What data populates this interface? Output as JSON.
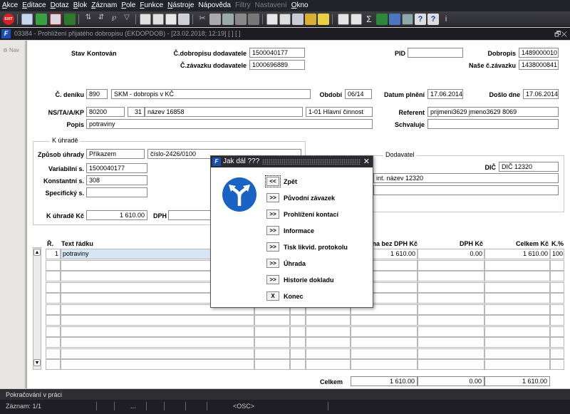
{
  "menu": [
    {
      "label": "Akce",
      "key": "A",
      "rest": "kce",
      "enabled": true
    },
    {
      "label": "Editace",
      "key": "E",
      "rest": "ditace",
      "enabled": true
    },
    {
      "label": "Dotaz",
      "key": "D",
      "rest": "otaz",
      "enabled": true
    },
    {
      "label": "Blok",
      "key": "B",
      "rest": "lok",
      "enabled": true
    },
    {
      "label": "Záznam",
      "key": "Z",
      "rest": "áznam",
      "enabled": true
    },
    {
      "label": "Pole",
      "key": "P",
      "rest": "ole",
      "enabled": true
    },
    {
      "label": "Funkce",
      "key": "F",
      "rest": "unkce",
      "enabled": true
    },
    {
      "label": "Nástroje",
      "key": "N",
      "rest": "ástroje",
      "enabled": true
    },
    {
      "label": "Nápověda",
      "key": "á",
      "rest": "",
      "enabled": true
    },
    {
      "label": "Filtry",
      "key": "",
      "rest": "",
      "enabled": false
    },
    {
      "label": "Nastavení",
      "key": "",
      "rest": "",
      "enabled": false
    },
    {
      "label": "Okno",
      "key": "O",
      "rest": "kno",
      "enabled": true
    }
  ],
  "window": {
    "title": "03384 - Prohlížení přijatého dobropisu (EKDOPDOB) - [23.02.2018; 12:19] [ ] [ ]",
    "logo": "F",
    "controls": "🗗✕"
  },
  "nav": {
    "label": "Nav"
  },
  "header": {
    "stav_label": "Stav",
    "stav_value": "Kontován",
    "cdobropisu_label": "Č.dobropisu dodavatele",
    "cdobropisu_value": "1500040177",
    "czavazku_label": "Č.závazku dodavatele",
    "czavazku_value": "1000696889",
    "pid_label": "PID",
    "pid_value": "",
    "dobropis_label": "Dobropis",
    "dobropis_value": "1489000010",
    "nase_label": "Naše č.závazku",
    "nase_value": "1438000841"
  },
  "journal": {
    "cdeniku_label": "Č. deníku",
    "cdeniku_value": "890",
    "cdeniku_name": "SKM - dobropis v KČ",
    "obdobi_label": "Období",
    "obdobi_value": "06/14",
    "datum_plneni_label": "Datum plnění",
    "datum_plneni_value": "17.06.2014",
    "doslo_label": "Došlo dne",
    "doslo_value": "17.06.2014",
    "ns_label": "NS/TA/A/KP",
    "ns_value": "80200",
    "ns_num": "31",
    "ns_name": "název 16858",
    "ns_cinnost": "1-01 Hlavní činnost",
    "referent_label": "Referent",
    "referent_value": "prijmeni3629 jmeno3629 8069",
    "popis_label": "Popis",
    "popis_value": "potraviny",
    "schvaluje_label": "Schvaluje",
    "schvaluje_value": ""
  },
  "kuhrade": {
    "group_label": "K úhradě",
    "zpusob_label": "Způsob úhrady",
    "zpusob_value": "Příkazem",
    "zpusob_ref": "číslo-2426/0100",
    "variabilni_label": "Variabilní s.",
    "variabilni_value": "1500040177",
    "konstantni_label": "Konstantní s.",
    "konstantni_value": "308",
    "specificky_label": "Specifický s.",
    "specificky_value": "",
    "kuhrade_label": "K úhradě Kč",
    "kuhrade_value": "1 610.00",
    "dph_label": "DPH",
    "dph_value": ""
  },
  "dodavatel": {
    "group_label": "Dodavatel",
    "dic_label": "DIČ",
    "dic_value": "DIČ 12320",
    "name_value": "int. název 12320"
  },
  "table": {
    "headers": {
      "r": "Ř.",
      "text": "Text řádku",
      "bez_dph": "Cena bez DPH Kč",
      "dph": "DPH Kč",
      "celkem": "Celkem Kč",
      "k": "K.%"
    },
    "rows": [
      {
        "r": "1",
        "text": "potraviny",
        "bez_dph": "1 610.00",
        "dph": "0.00",
        "celkem": "1 610.00",
        "k": "100"
      }
    ],
    "footer": {
      "label": "Celkem",
      "bez_dph": "1 610.00",
      "dph": "0.00",
      "celkem": "1 610.00"
    }
  },
  "status": {
    "message": "Pokračování v práci",
    "record": "Záznam: 1/1",
    "ellipsis": "...",
    "osc": "<OSC>"
  },
  "dialog": {
    "title": "Jak dál ???",
    "close": "✕",
    "logo": "F",
    "icon": "road-fork-sign-icon",
    "options": [
      {
        "btn": "<<",
        "label": "Zpět",
        "selected": true
      },
      {
        "btn": ">>",
        "label": "Původní závazek"
      },
      {
        "btn": ">>",
        "label": "Prohlížení kontací"
      },
      {
        "btn": ">>",
        "label": "Informace"
      },
      {
        "btn": ">>",
        "label": "Tisk likvid. protokolu"
      },
      {
        "btn": ">>",
        "label": "Úhrada"
      },
      {
        "btn": ">>",
        "label": "Historie dokladu"
      },
      {
        "btn": "X",
        "label": "Konec"
      }
    ]
  }
}
